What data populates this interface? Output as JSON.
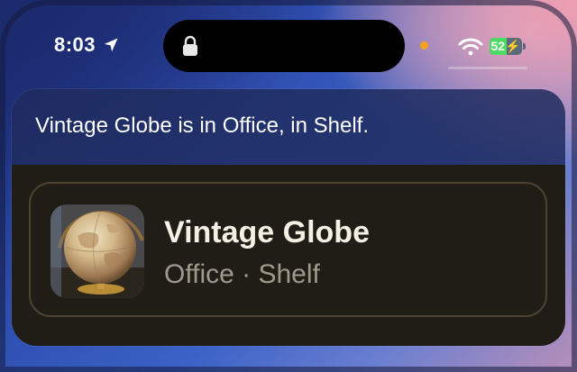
{
  "status_bar": {
    "time": "8:03",
    "battery_percent": 52,
    "battery_text": "52",
    "location_icon": "location-arrow-icon",
    "lock_icon": "lock-icon",
    "wifi_icon": "wifi-icon",
    "battery_icon": "battery-charging-icon",
    "privacy_indicator_color": "#f5a11a"
  },
  "siri": {
    "response": "Vintage Globe is in Office, in Shelf."
  },
  "result_card": {
    "title": "Vintage Globe",
    "subtitle": "Office · Shelf",
    "thumbnail": "globe-photo"
  },
  "colors": {
    "panel_background": "#201d17",
    "card_border": "#49432f",
    "title": "#f4f0e3",
    "subtitle": "#9f998b",
    "battery_fill": "#4cd964"
  }
}
